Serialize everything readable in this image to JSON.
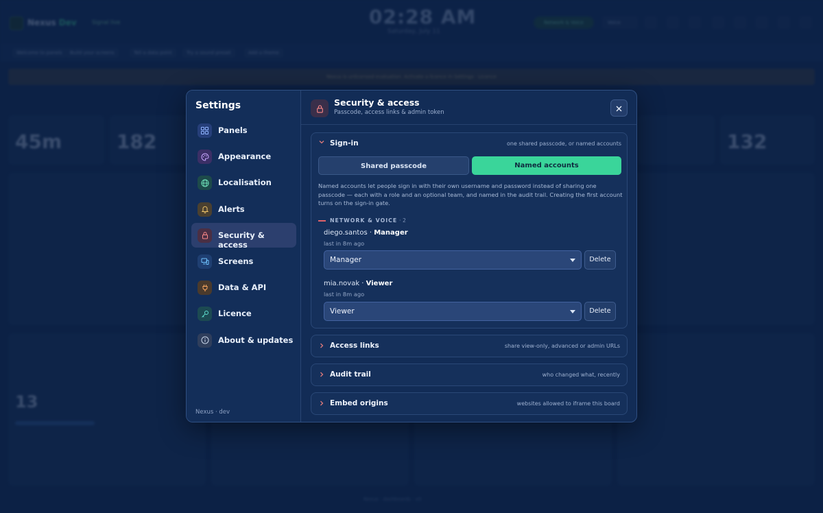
{
  "background": {
    "brand": "Nexus",
    "brand_accent": "Dev",
    "status": "Signal live",
    "clock": "02:28 AM",
    "date": "Saturday, July 11",
    "live_pill": "Network & Voice",
    "select": "Voice",
    "banner_chips": [
      "Welcome to panels",
      "Build your screens",
      "Tell a data point",
      "Try a sound preset",
      "Add a theme"
    ],
    "notice": "Nexus is unlicensed evaluation. Activate a licence in Settings · Licence",
    "stat_1": "45m",
    "stat_2": "182",
    "stat_3": "132",
    "stat_4": "13",
    "footer": "Nexus · dashboards · v0"
  },
  "settings": {
    "title": "Settings",
    "footer": "Nexus · dev",
    "nav": [
      {
        "label": "Panels",
        "icon": "grid-icon"
      },
      {
        "label": "Appearance",
        "icon": "palette-icon"
      },
      {
        "label": "Localisation",
        "icon": "globe-icon"
      },
      {
        "label": "Alerts",
        "icon": "bell-icon"
      },
      {
        "label": "Security & access",
        "icon": "lock-icon"
      },
      {
        "label": "Screens",
        "icon": "monitor-icon"
      },
      {
        "label": "Data & API",
        "icon": "plug-icon"
      },
      {
        "label": "Licence",
        "icon": "key-icon"
      },
      {
        "label": "About & updates",
        "icon": "info-icon"
      }
    ],
    "active_nav": "Security & access"
  },
  "panel": {
    "title": "Security & access",
    "subtitle": "Passcode, access links & admin token",
    "signin": {
      "title": "Sign-in",
      "hint": "one shared passcode, or named accounts",
      "mode_shared": "Shared passcode",
      "mode_named": "Named accounts",
      "selected_mode": "Named accounts",
      "description": "Named accounts let people sign in with their own username and password instead of sharing one passcode — each with a role and an optional team, and named in the audit trail. Creating the first account turns on the sign-in gate.",
      "group": {
        "label": "NETWORK & VOICE",
        "count": "· 2",
        "accounts": [
          {
            "user": "diego.santos",
            "sep": " · ",
            "role": "Manager",
            "last": "last in 8m ago",
            "select_value": "Manager",
            "delete": "Delete"
          },
          {
            "user": "mia.novak",
            "sep": " · ",
            "role": "Viewer",
            "last": "last in 8m ago",
            "select_value": "Viewer",
            "delete": "Delete"
          }
        ]
      }
    },
    "access_links": {
      "title": "Access links",
      "hint": "share view-only, advanced or admin URLs"
    },
    "audit_trail": {
      "title": "Audit trail",
      "hint": "who changed what, recently"
    },
    "embed_origins": {
      "title": "Embed origins",
      "hint": "websites allowed to iframe this board"
    }
  },
  "colors": {
    "accent_green": "#3ad59a",
    "danger_red": "#e0626a",
    "panel_bg": "#122c56"
  }
}
